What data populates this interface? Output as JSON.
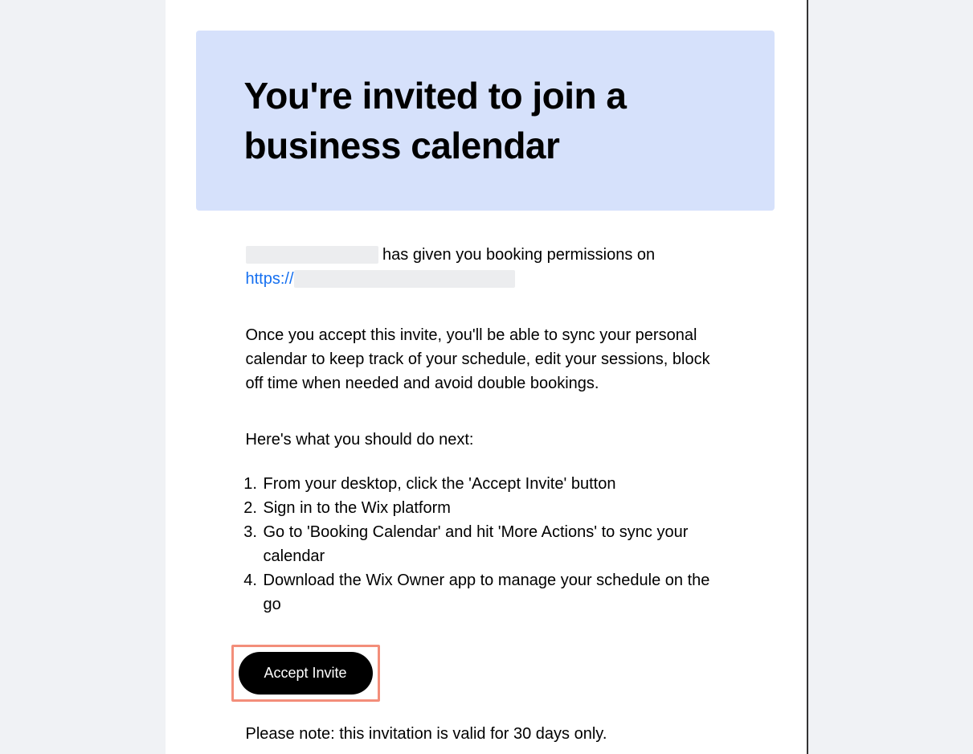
{
  "banner": {
    "title": "You're invited to join a business calendar"
  },
  "intro": {
    "text_after_name": " has given you booking permissions on ",
    "link_prefix": "https://"
  },
  "description": "Once you accept this invite, you'll be able to sync your personal calendar to keep track of your schedule, edit your sessions, block off time when needed and avoid double bookings.",
  "next_steps_heading": "Here's what you should do next:",
  "steps": [
    "From your desktop, click the 'Accept Invite' button",
    "Sign in to the Wix platform",
    "Go to 'Booking Calendar' and hit 'More Actions' to sync your calendar",
    "Download the Wix Owner app to manage your schedule on the go"
  ],
  "button": {
    "accept_label": "Accept Invite"
  },
  "note": "Please note: this invitation is valid for 30 days only."
}
